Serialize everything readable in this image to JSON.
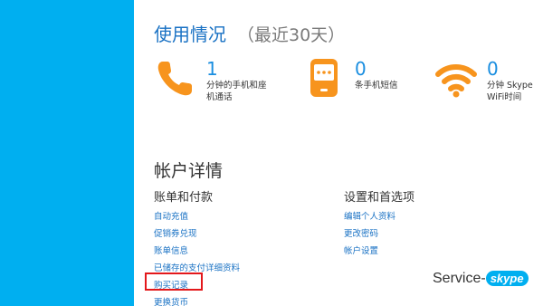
{
  "usage": {
    "title": "使用情况",
    "subtitle": "（最近30天）",
    "stats": [
      {
        "icon": "phone-icon",
        "value": "1",
        "description": "分钟的手机和座机通话"
      },
      {
        "icon": "sms-icon",
        "value": "0",
        "description": "条手机短信"
      },
      {
        "icon": "wifi-icon",
        "value": "0",
        "description": "分钟 Skype WiFi时间"
      }
    ]
  },
  "account": {
    "title": "帐户详情",
    "billing": {
      "heading": "账单和付款",
      "links": [
        "自动充值",
        "促销券兑现",
        "账单信息",
        "已储存的支付详细资料",
        "购买记录",
        "更换货币"
      ]
    },
    "settings": {
      "heading": "设置和首选项",
      "links": [
        "编辑个人资料",
        "更改密码",
        "帐户设置"
      ]
    }
  },
  "watermark": {
    "text": "Service-",
    "brand": "skype"
  },
  "colors": {
    "sidebar": "#00aff0",
    "accent_orange": "#f7941d",
    "link_blue": "#1a72c4",
    "highlight_red": "#e3181b"
  }
}
